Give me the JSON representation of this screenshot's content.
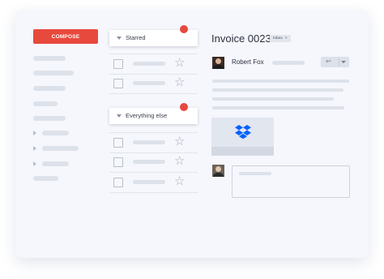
{
  "sidebar": {
    "compose_label": "COMPOSE",
    "compose_color": "#e8493d",
    "items": [
      {
        "kind": "item"
      },
      {
        "kind": "item"
      },
      {
        "kind": "item"
      },
      {
        "kind": "item"
      },
      {
        "kind": "item"
      },
      {
        "kind": "expandable"
      },
      {
        "kind": "expandable"
      },
      {
        "kind": "expandable"
      },
      {
        "kind": "item"
      }
    ]
  },
  "list": {
    "sections": [
      {
        "label": "Starred",
        "unread_indicator": true,
        "rows": 2
      },
      {
        "label": "Everything else",
        "unread_indicator": true,
        "rows": 3
      }
    ]
  },
  "message": {
    "subject": "Invoice 0023",
    "label_badge": "Inbox",
    "label_remove": "×",
    "sender_name": "Robert Fox",
    "attachment_icon": "dropbox-icon",
    "dropbox_color": "#0061fe"
  }
}
